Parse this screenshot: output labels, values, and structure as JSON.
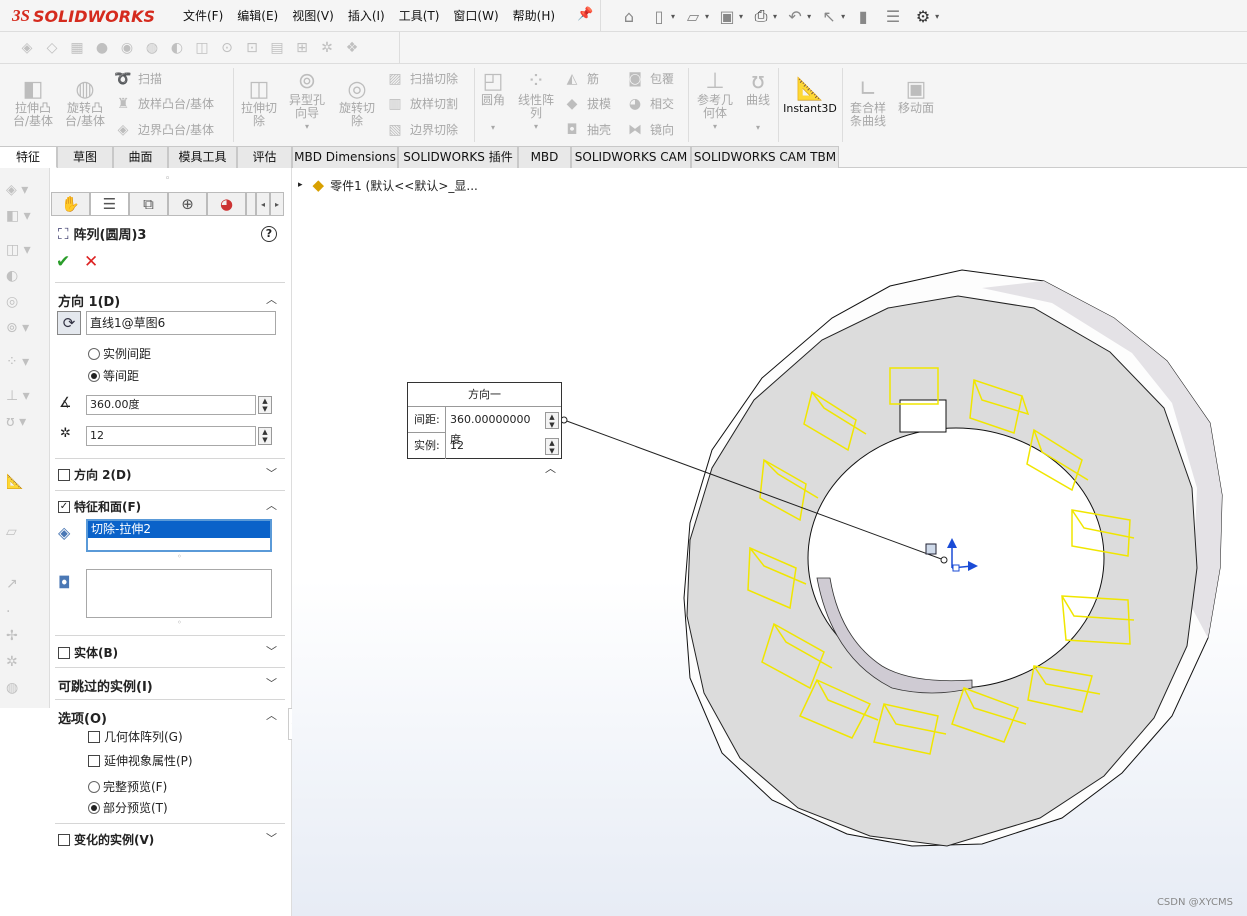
{
  "app": {
    "logo_ds": "3S",
    "logo_name": "SOLIDWORKS"
  },
  "menu": [
    "文件(F)",
    "编辑(E)",
    "视图(V)",
    "插入(I)",
    "工具(T)",
    "窗口(W)",
    "帮助(H)"
  ],
  "ribbon": {
    "extrude_boss": "拉伸凸\n台/基体",
    "revolve_boss": "旋转凸\n台/基体",
    "sweep": "扫描",
    "loft": "放样凸台/基体",
    "boundary": "边界凸台/基体",
    "extrude_cut": "拉伸切\n除",
    "hole_wizard": "异型孔\n向导",
    "revolve_cut": "旋转切\n除",
    "swept_cut": "扫描切除",
    "lofted_cut": "放样切割",
    "boundary_cut": "边界切除",
    "fillet": "圆角",
    "linear_pattern": "线性阵\n列",
    "rib": "筋",
    "wrap": "包覆",
    "draft": "拔模",
    "intersect": "相交",
    "shell": "抽壳",
    "mirror": "镜向",
    "ref_geometry": "参考几\n何体",
    "curves": "曲线",
    "instant3d": "Instant3D",
    "spline": "套合样\n条曲线",
    "move_face": "移动面"
  },
  "tabs": [
    "特征",
    "草图",
    "曲面",
    "模具工具",
    "评估",
    "MBD Dimensions",
    "SOLIDWORKS 插件",
    "MBD",
    "SOLIDWORKS CAM",
    "SOLIDWORKS CAM TBM"
  ],
  "tree": {
    "label": "零件1  (默认<<默认>_显..."
  },
  "pm": {
    "title": "阵列(圆周)3",
    "help": "?",
    "ok": "✔",
    "cancel": "✕",
    "dir1": {
      "header": "方向 1(D)",
      "axis": "直线1@草图6",
      "opt_spacing": "实例间距",
      "opt_equal": "等间距",
      "angle": "360.00度",
      "count": "12"
    },
    "dir2": {
      "header": "方向 2(D)"
    },
    "features": {
      "header": "特征和面(F)",
      "item": "切除-拉伸2"
    },
    "bodies": {
      "header": "实体(B)"
    },
    "skip": {
      "header": "可跳过的实例(I)"
    },
    "options": {
      "header": "选项(O)",
      "geom": "几何体阵列(G)",
      "visual": "延伸视象属性(P)",
      "full": "完整预览(F)",
      "partial": "部分预览(T)"
    },
    "varied": {
      "header": "变化的实例(V)"
    }
  },
  "callout": {
    "title": "方向一",
    "spacing_label": "间距:",
    "spacing": "360.00000000度",
    "instances_label": "实例:",
    "instances": "12"
  },
  "watermark": "CSDN @XYCMS"
}
